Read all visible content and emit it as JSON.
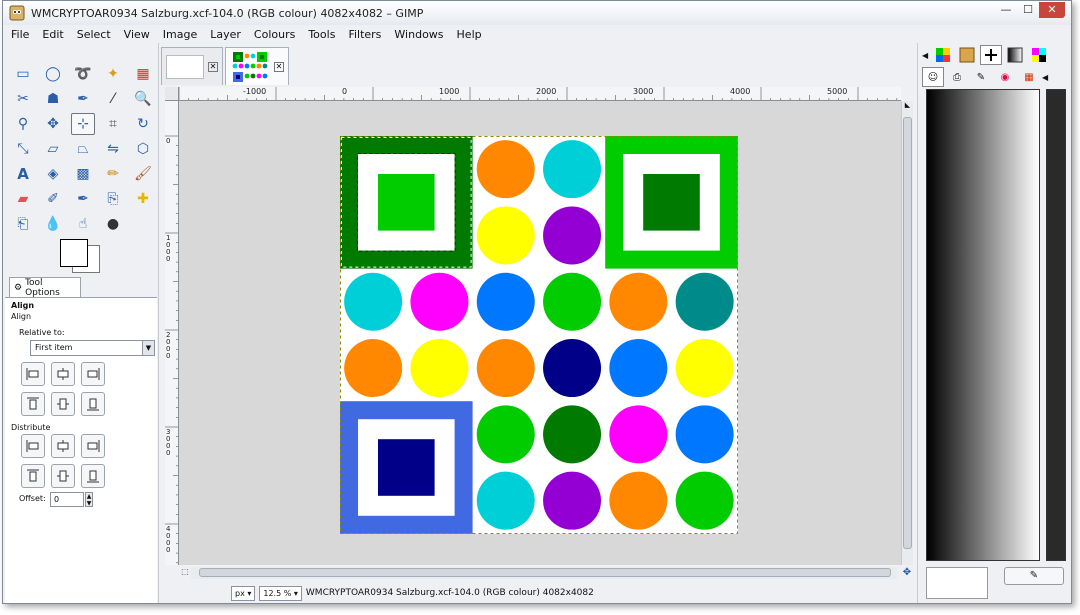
{
  "window": {
    "title": "WMCRYPTOAR0934 Salzburg.xcf-104.0 (RGB colour) 4082x4082 – GIMP",
    "controls": {
      "minimize": "—",
      "maximize": "☐",
      "close": "✕"
    }
  },
  "menu": [
    {
      "label": "File"
    },
    {
      "label": "Edit"
    },
    {
      "label": "Select"
    },
    {
      "label": "View"
    },
    {
      "label": "Image"
    },
    {
      "label": "Layer"
    },
    {
      "label": "Colours"
    },
    {
      "label": "Tools"
    },
    {
      "label": "Filters"
    },
    {
      "label": "Windows"
    },
    {
      "label": "Help"
    }
  ],
  "toolbox": {
    "tools": [
      "rect-select",
      "ellipse-select",
      "free-select",
      "fuzzy-select",
      "select-by-color",
      "scissors-select",
      "foreground-select",
      "paths",
      "color-picker",
      "zoom",
      "measure",
      "move",
      "align",
      "crop",
      "rotate",
      "scale",
      "shear",
      "perspective",
      "flip",
      "cage-transform",
      "text",
      "bucket-fill",
      "blend",
      "pencil",
      "paintbrush",
      "eraser",
      "airbrush",
      "ink",
      "clone",
      "heal",
      "perspective-clone",
      "blur",
      "smudge",
      "dodge-burn"
    ],
    "active_tool": "align",
    "foreground_color": "#ffffff",
    "background_color": "#ffffff"
  },
  "tool_options": {
    "tab_label": "Tool Options",
    "heading": "Align",
    "section_align": "Align",
    "relative_to_label": "Relative to:",
    "relative_to_value": "First item",
    "distribute_label": "Distribute",
    "offset_label": "Offset:",
    "offset_value": "0"
  },
  "rulers": {
    "horizontal": [
      {
        "label": "-1000"
      },
      {
        "label": "0"
      },
      {
        "label": "1000"
      },
      {
        "label": "2000"
      },
      {
        "label": "3000"
      },
      {
        "label": "4000"
      },
      {
        "label": "5000"
      }
    ],
    "vertical": [
      {
        "label": "0"
      },
      {
        "label": "1000"
      },
      {
        "label": "2000"
      },
      {
        "label": "3000"
      },
      {
        "label": "4000"
      }
    ]
  },
  "status": {
    "unit": "px",
    "zoom": "12.5 %",
    "text": "WMCRYPTOAR0934 Salzburg.xcf-104.0 (RGB colour) 4082x4082"
  },
  "image": {
    "colors": {
      "dark_green": "#007a00",
      "green": "#00cc00",
      "royal_blue": "#4169e1",
      "navy": "#000088",
      "orange": "#ff8800",
      "cyan": "#00cfd8",
      "yellow": "#ffff00",
      "purple": "#9400d3",
      "magenta": "#ff00ff",
      "blue": "#0077ff",
      "teal": "#008b8b"
    },
    "circles": [
      [
        "orange",
        "cyan"
      ],
      [
        "yellow",
        "purple"
      ],
      [
        "cyan",
        "magenta",
        "blue",
        "green",
        "orange",
        "teal"
      ],
      [
        "orange",
        "yellow",
        "orange",
        "navy",
        "blue",
        "yellow"
      ],
      [
        "green",
        "dark_green",
        "magenta",
        "blue"
      ],
      [
        "cyan",
        "purple",
        "orange",
        "green"
      ]
    ]
  }
}
